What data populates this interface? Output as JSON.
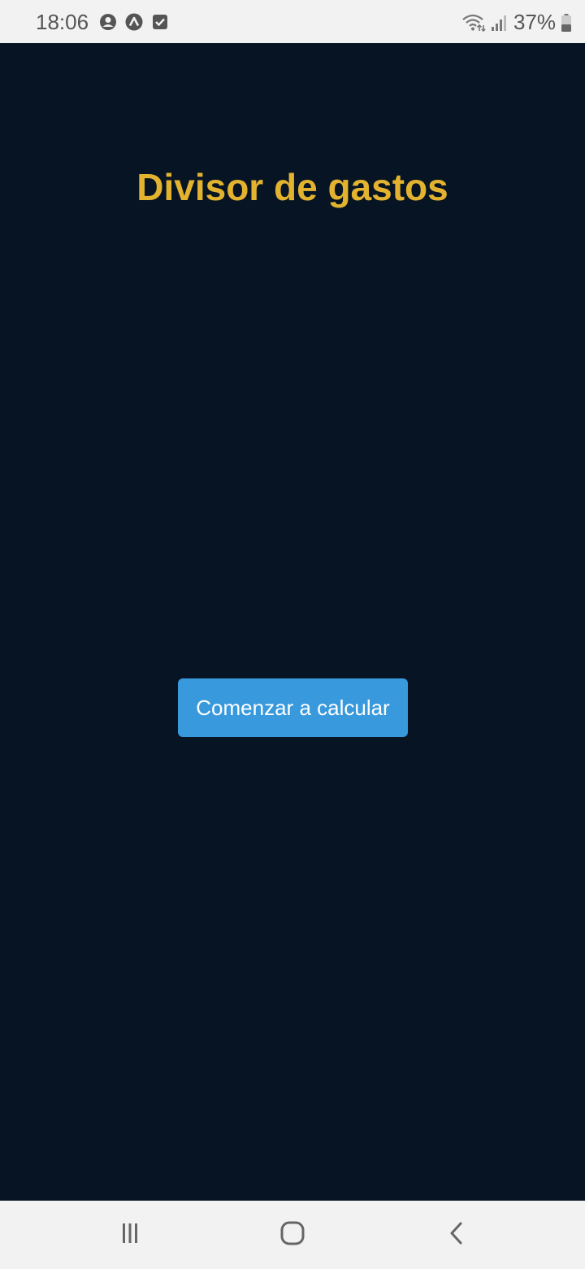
{
  "status_bar": {
    "time": "18:06",
    "battery": "37%",
    "icons": [
      "account-circle-icon",
      "arrow-up-circle-icon",
      "checkbox-icon",
      "wifi-icon",
      "signal-icon",
      "battery-icon"
    ]
  },
  "app": {
    "title": "Divisor de gastos",
    "start_button_label": "Comenzar a calcular",
    "colors": {
      "background": "#061423",
      "title": "#e3b22f",
      "button": "#3899dd"
    }
  },
  "nav_bar": {
    "icons": [
      "recent-apps-icon",
      "home-icon",
      "back-icon"
    ]
  }
}
